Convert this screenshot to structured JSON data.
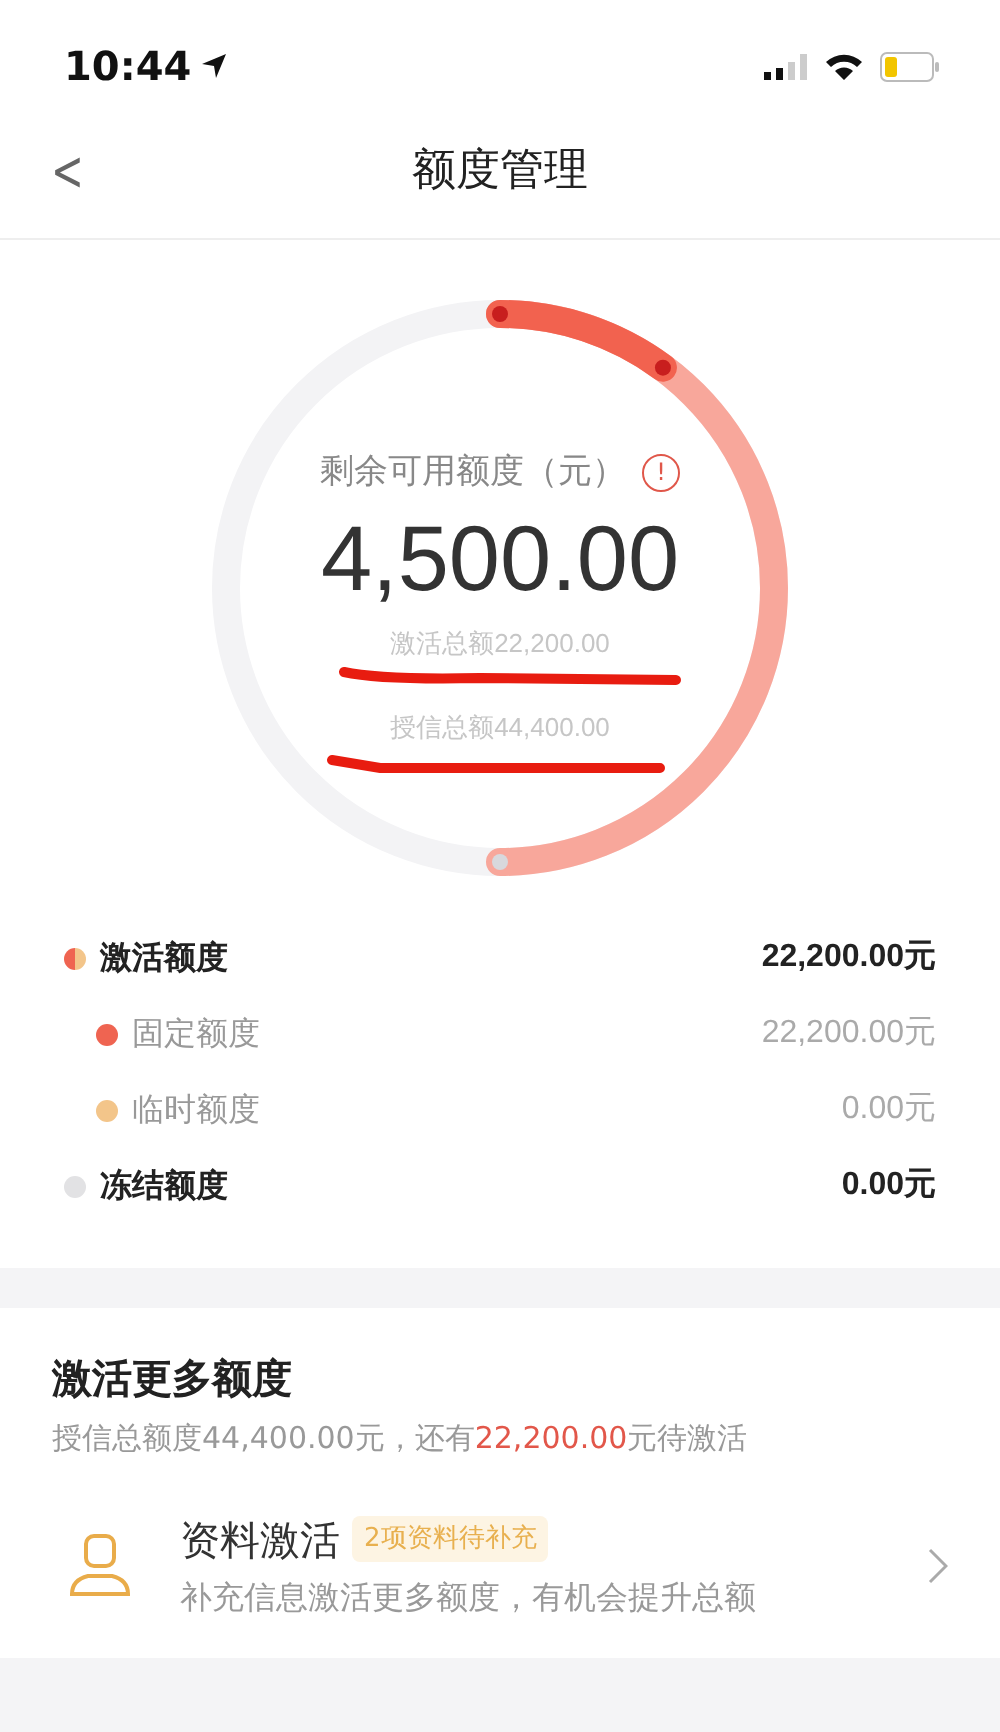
{
  "status_bar": {
    "time": "10:44"
  },
  "nav": {
    "back": "<",
    "title": "额度管理"
  },
  "ring": {
    "label": "剩余可用额度（元）",
    "info": "!",
    "amount": "4,500.00",
    "active_total": "激活总额22,200.00",
    "credit_total": "授信总额44,400.00",
    "segments": [
      {
        "color": "#f8a79b"
      },
      {
        "color": "#f2624f"
      }
    ]
  },
  "quota_items": [
    {
      "label": "激活额度",
      "value": "22,200.00元",
      "children": [
        {
          "label": "固定额度",
          "value": "22,200.00元",
          "color": "#ef6451"
        },
        {
          "label": "临时额度",
          "value": "0.00元",
          "color": "#f3c58a"
        }
      ]
    },
    {
      "label": "冻结额度",
      "value": "0.00元",
      "color": "#e2e2e4"
    }
  ],
  "activate": {
    "title": "激活更多额度",
    "summary_parts": [
      "授信总额度44,400.00元，还有",
      "22,200.00",
      "元待激活"
    ],
    "entry": {
      "title": "资料激活",
      "tag": "2项资料待补充",
      "desc": "补充信息激活更多额度，有机会提升总额"
    }
  }
}
